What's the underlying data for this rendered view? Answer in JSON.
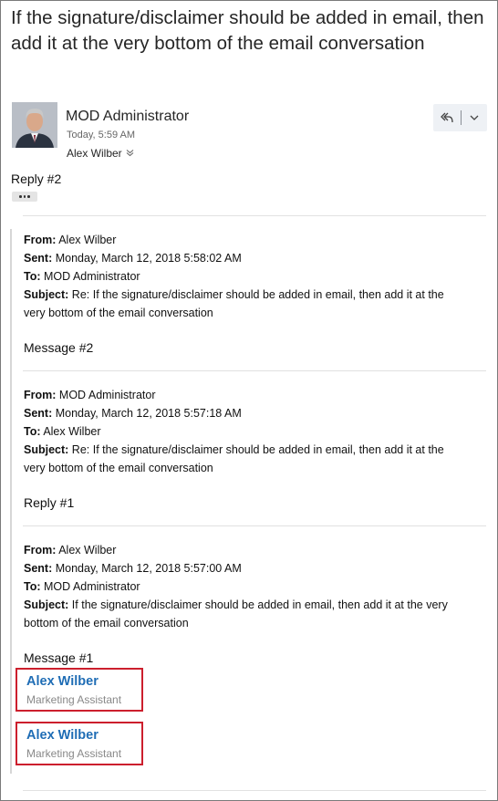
{
  "email": {
    "subject": "If the signature/disclaimer should be added in email, then add it at the very bottom of the email conversation",
    "sender": "MOD Administrator",
    "time": "Today, 5:59 AM",
    "recipient": "Alex Wilber",
    "body": "Reply #2"
  },
  "labels": {
    "from": "From:",
    "sent": "Sent:",
    "to": "To:",
    "subject": "Subject:"
  },
  "quotes": [
    {
      "from": "Alex Wilber",
      "sent": "Monday, March 12, 2018 5:58:02 AM",
      "to": "MOD Administrator",
      "subject_prefix": "Re:",
      "subject_line1": "If the signature/disclaimer should be added in email, then add it at the",
      "subject_line2": "very bottom of the email conversation",
      "body": "Message #2"
    },
    {
      "from": "MOD Administrator",
      "sent": "Monday, March 12, 2018 5:57:18 AM",
      "to": "Alex Wilber",
      "subject_prefix": "Re:",
      "subject_line1": "If the signature/disclaimer should be added in email, then add it at the",
      "subject_line2": "very bottom of the email conversation",
      "body": "Reply #1"
    },
    {
      "from": "Alex Wilber",
      "sent": "Monday, March 12, 2018 5:57:00 AM",
      "to": "MOD Administrator",
      "subject_prefix": "",
      "subject_line1": "If the signature/disclaimer should be added in email, then add it at the very",
      "subject_line2": "bottom of the email conversation",
      "body": "Message #1"
    }
  ],
  "signatures": [
    {
      "name": "Alex Wilber",
      "title": "Marketing Assistant"
    },
    {
      "name": "Alex Wilber",
      "title": "Marketing Assistant"
    }
  ],
  "colors": {
    "signature_name": "#1f6db5",
    "highlight_border": "#cc1f2d"
  },
  "icons": {
    "reply_all": "reply-all-icon",
    "more": "chevron-down-icon",
    "expand_recipients": "chevron-double-down-icon"
  }
}
